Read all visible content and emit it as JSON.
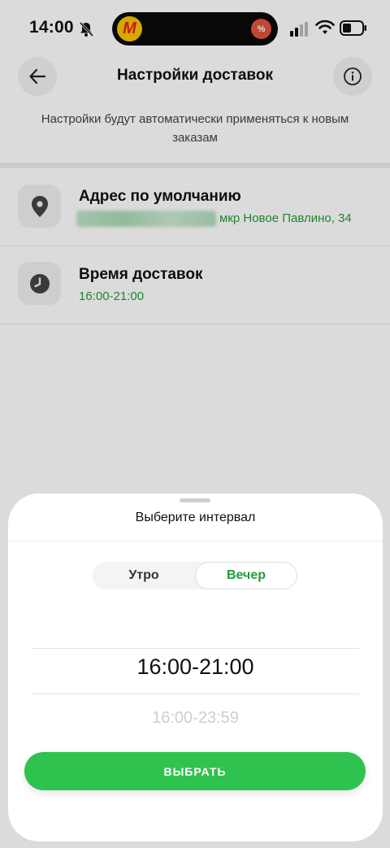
{
  "status_bar": {
    "time": "14:00",
    "island_app_glyph": "M",
    "island_badge_glyph": "%"
  },
  "header": {
    "title": "Настройки доставок"
  },
  "subtitle": "Настройки будут автоматически применяться к новым заказам",
  "settings": {
    "address": {
      "title": "Адрес по умолчанию",
      "value": "мкр Новое Павлино, 34",
      "icon": "location-pin-icon"
    },
    "time": {
      "title": "Время доставок",
      "value": "16:00-21:00",
      "icon": "clock-icon"
    }
  },
  "sheet": {
    "title": "Выберите интервал",
    "tabs": [
      {
        "label": "Утро",
        "selected": false
      },
      {
        "label": "Вечер",
        "selected": true
      }
    ],
    "intervals": [
      {
        "label": "16:00-21:00",
        "selected": true
      },
      {
        "label": "16:00-23:59",
        "selected": false
      }
    ],
    "button_label": "ВЫБРАТЬ"
  },
  "colors": {
    "accent_green": "#2fc24f",
    "text_green": "#1e9e3c"
  }
}
